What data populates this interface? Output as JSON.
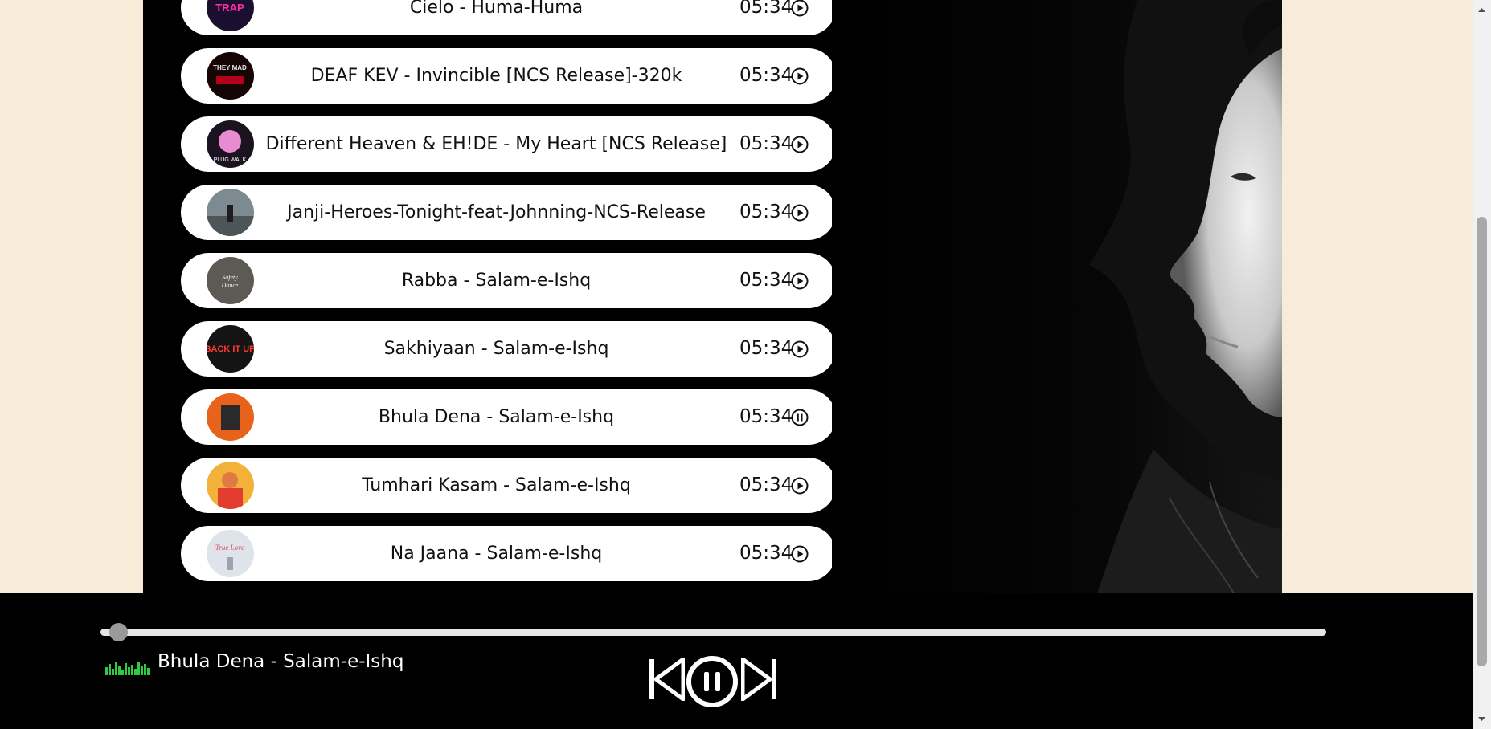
{
  "songs": [
    {
      "title": "Cielo - Huma-Huma",
      "duration": "05:34",
      "state": "play",
      "cover_icon": "album-cover"
    },
    {
      "title": "DEAF KEV - Invincible [NCS Release]-320k",
      "duration": "05:34",
      "state": "play",
      "cover_icon": "album-cover"
    },
    {
      "title": "Different Heaven & EH!DE - My Heart [NCS Release]",
      "duration": "05:34",
      "state": "play",
      "cover_icon": "album-cover"
    },
    {
      "title": "Janji-Heroes-Tonight-feat-Johnning-NCS-Release",
      "duration": "05:34",
      "state": "play",
      "cover_icon": "album-cover"
    },
    {
      "title": "Rabba - Salam-e-Ishq",
      "duration": "05:34",
      "state": "play",
      "cover_icon": "album-cover"
    },
    {
      "title": "Sakhiyaan - Salam-e-Ishq",
      "duration": "05:34",
      "state": "play",
      "cover_icon": "album-cover"
    },
    {
      "title": "Bhula Dena - Salam-e-Ishq",
      "duration": "05:34",
      "state": "pause",
      "cover_icon": "album-cover"
    },
    {
      "title": "Tumhari Kasam - Salam-e-Ishq",
      "duration": "05:34",
      "state": "play",
      "cover_icon": "album-cover"
    },
    {
      "title": "Na Jaana - Salam-e-Ishq",
      "duration": "05:34",
      "state": "play",
      "cover_icon": "album-cover"
    }
  ],
  "player": {
    "now_playing": "Bhula Dena - Salam-e-Ishq",
    "progress": 0.0,
    "is_playing": true,
    "controls": [
      "previous-icon",
      "pause-icon",
      "next-icon"
    ]
  },
  "colors": {
    "page_background": "#f8ebd8",
    "container": "#000000",
    "song_card": "#ffffff",
    "equalizer": "#2ecc40"
  }
}
